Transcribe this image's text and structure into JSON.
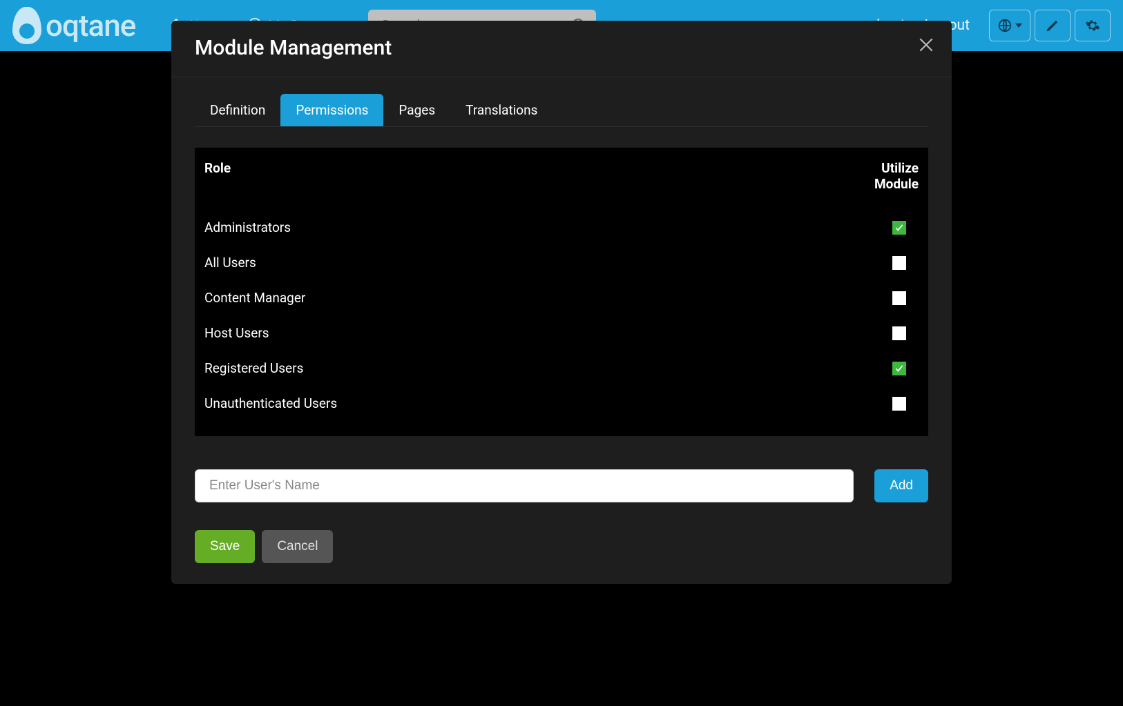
{
  "brand": {
    "name": "oqtane"
  },
  "nav": {
    "home_label": "Home",
    "mypage_label": "My Page",
    "search_placeholder": "Search",
    "user_label": "host",
    "logout_label": "Logout"
  },
  "modal": {
    "title": "Module Management",
    "tabs": {
      "definition": "Definition",
      "permissions": "Permissions",
      "pages": "Pages",
      "translations": "Translations",
      "active": "permissions"
    },
    "permissions": {
      "columns": {
        "role": "Role",
        "utilize": "Utilize Module"
      },
      "rows": [
        {
          "role": "Administrators",
          "checked": true
        },
        {
          "role": "All Users",
          "checked": false
        },
        {
          "role": "Content Manager",
          "checked": false
        },
        {
          "role": "Host Users",
          "checked": false
        },
        {
          "role": "Registered Users",
          "checked": true
        },
        {
          "role": "Unauthenticated Users",
          "checked": false
        }
      ]
    },
    "user_add": {
      "placeholder": "Enter User's Name",
      "add_label": "Add"
    },
    "actions": {
      "save_label": "Save",
      "cancel_label": "Cancel"
    }
  }
}
